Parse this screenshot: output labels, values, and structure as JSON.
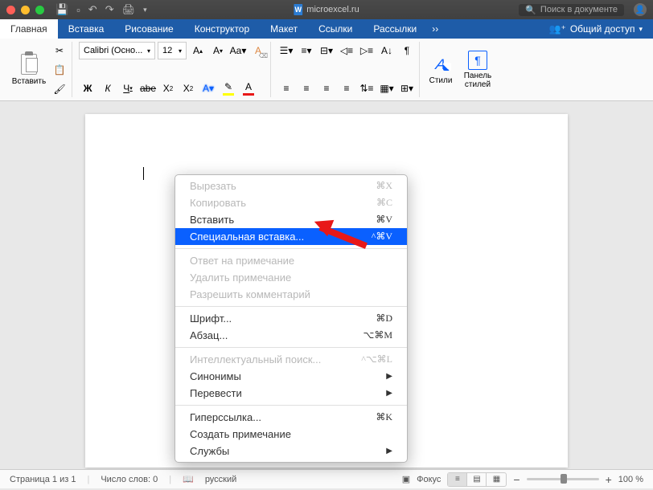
{
  "titlebar": {
    "doc_name": "microexcel.ru",
    "search_placeholder": "Поиск в документе"
  },
  "tabs": {
    "items": [
      "Главная",
      "Вставка",
      "Рисование",
      "Конструктор",
      "Макет",
      "Ссылки",
      "Рассылки"
    ],
    "share_label": "Общий доступ"
  },
  "ribbon": {
    "paste_label": "Вставить",
    "font_name": "Calibri (Осно...",
    "font_size": "12",
    "styles_label": "Стили",
    "panel_label": "Панель\nстилей"
  },
  "context": {
    "items": [
      {
        "label": "Вырезать",
        "shortcut": "⌘X",
        "disabled": true
      },
      {
        "label": "Копировать",
        "shortcut": "⌘C",
        "disabled": true
      },
      {
        "label": "Вставить",
        "shortcut": "⌘V"
      },
      {
        "label": "Специальная вставка...",
        "shortcut": "^⌘V",
        "selected": true
      },
      {
        "sep": true
      },
      {
        "label": "Ответ на примечание",
        "disabled": true
      },
      {
        "label": "Удалить примечание",
        "disabled": true
      },
      {
        "label": "Разрешить комментарий",
        "disabled": true
      },
      {
        "sep": true
      },
      {
        "label": "Шрифт...",
        "shortcut": "⌘D"
      },
      {
        "label": "Абзац...",
        "shortcut": "⌥⌘M"
      },
      {
        "sep": true
      },
      {
        "label": "Интеллектуальный поиск...",
        "shortcut": "^⌥⌘L",
        "disabled": true
      },
      {
        "label": "Синонимы",
        "arrow": true
      },
      {
        "label": "Перевести",
        "arrow": true
      },
      {
        "sep": true
      },
      {
        "label": "Гиперссылка...",
        "shortcut": "⌘K"
      },
      {
        "label": "Создать примечание"
      },
      {
        "label": "Службы",
        "arrow": true
      }
    ]
  },
  "status": {
    "page": "Страница 1 из 1",
    "words": "Число слов: 0",
    "lang": "русский",
    "focus": "Фокус",
    "zoom": "100 %"
  }
}
